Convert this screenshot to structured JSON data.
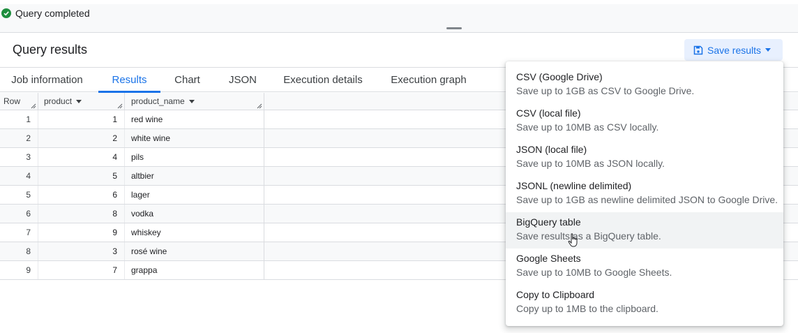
{
  "status": {
    "text": "Query completed"
  },
  "results": {
    "title": "Query results",
    "save_label": "Save results"
  },
  "tabs": [
    {
      "label": "Job information"
    },
    {
      "label": "Results"
    },
    {
      "label": "Chart"
    },
    {
      "label": "JSON"
    },
    {
      "label": "Execution details"
    },
    {
      "label": "Execution graph"
    }
  ],
  "table": {
    "columns": [
      "Row",
      "product",
      "product_name"
    ],
    "rows": [
      {
        "row": "1",
        "product": "1",
        "product_name": "red wine"
      },
      {
        "row": "2",
        "product": "2",
        "product_name": "white wine"
      },
      {
        "row": "3",
        "product": "4",
        "product_name": "pils"
      },
      {
        "row": "4",
        "product": "5",
        "product_name": "altbier"
      },
      {
        "row": "5",
        "product": "6",
        "product_name": "lager"
      },
      {
        "row": "6",
        "product": "8",
        "product_name": "vodka"
      },
      {
        "row": "7",
        "product": "9",
        "product_name": "whiskey"
      },
      {
        "row": "8",
        "product": "3",
        "product_name": "rosé wine"
      },
      {
        "row": "9",
        "product": "7",
        "product_name": "grappa"
      }
    ]
  },
  "menu": {
    "items": [
      {
        "title": "CSV (Google Drive)",
        "desc": "Save up to 1GB as CSV to Google Drive."
      },
      {
        "title": "CSV (local file)",
        "desc": "Save up to 10MB as CSV locally."
      },
      {
        "title": "JSON (local file)",
        "desc": "Save up to 10MB as JSON locally."
      },
      {
        "title": "JSONL (newline delimited)",
        "desc": "Save up to 1GB as newline delimited JSON to Google Drive."
      },
      {
        "title": "BigQuery table",
        "desc": "Save results as a BigQuery table."
      },
      {
        "title": "Google Sheets",
        "desc": "Save up to 10MB to Google Sheets."
      },
      {
        "title": "Copy to Clipboard",
        "desc": "Copy up to 1MB to the clipboard."
      }
    ]
  },
  "colors": {
    "accent": "#1a73e8",
    "success": "#1e8e3e",
    "button_bg": "#e8f0fe"
  }
}
